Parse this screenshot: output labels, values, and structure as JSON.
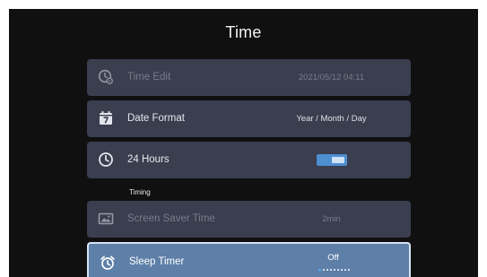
{
  "title": "Time",
  "items": [
    {
      "label": "Time Edit",
      "value": "2021/05/12 04:11",
      "icon": "clock-settings-icon",
      "enabled": false
    },
    {
      "label": "Date Format",
      "value": "Year / Month / Day",
      "icon": "calendar-icon",
      "enabled": true
    },
    {
      "label": "24 Hours",
      "value": "",
      "icon": "clock-icon",
      "enabled": true,
      "toggle_on": true
    }
  ],
  "section": "Timing",
  "timing_items": [
    {
      "label": "Screen Saver Time",
      "value": "2min",
      "icon": "screen-saver-icon",
      "enabled": false
    },
    {
      "label": "Sleep Timer",
      "value": "Off",
      "icon": "alarm-clock-icon",
      "enabled": true,
      "selected": true,
      "option_count": 9,
      "option_index": 0
    }
  ],
  "colors": {
    "background": "#101011",
    "row": "#3a3e4f",
    "row_selected": "#5d7fa8",
    "accent": "#4d8fd1"
  }
}
